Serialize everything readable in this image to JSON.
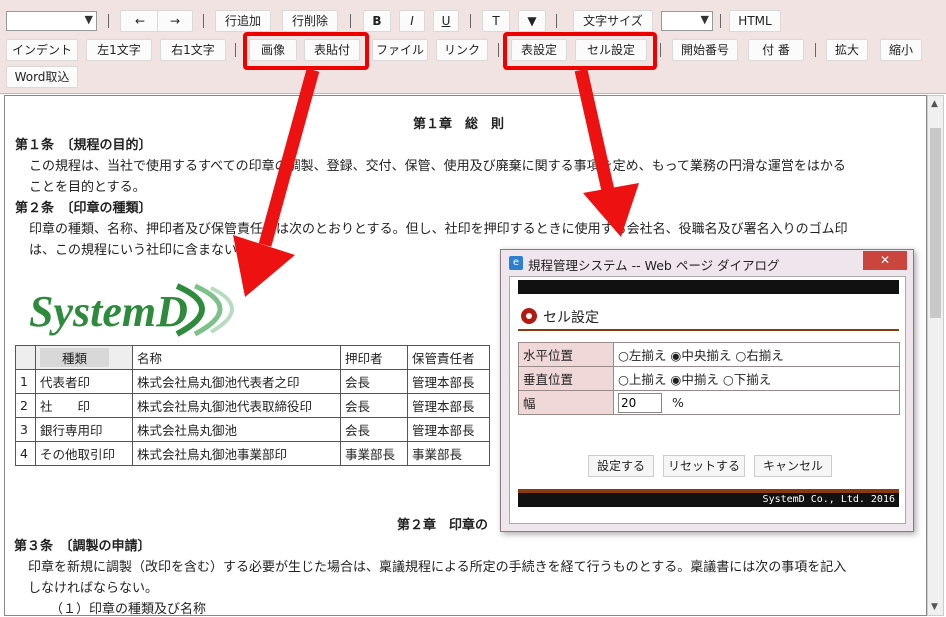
{
  "toolbar": {
    "row1": {
      "prev": "←",
      "next": "→",
      "add_row": "行追加",
      "del_row": "行削除",
      "bold": "B",
      "italic": "I",
      "underline": "U",
      "text": "T",
      "color_menu": "▼",
      "font_size": "文字サイズ",
      "html": "HTML"
    },
    "row2": {
      "indent": "インデント",
      "left_char": "左1文字",
      "right_char": "右1文字",
      "image": "画像",
      "paste_table": "表貼付",
      "file": "ファイル",
      "link": "リンク",
      "table_settings": "表設定",
      "cell_settings": "セル設定",
      "start_number": "開始番号",
      "numbering": "付 番",
      "zoom_in": "拡大",
      "zoom_out": "縮小"
    },
    "row3": {
      "word_import": "Word取込"
    }
  },
  "document": {
    "chapter1": "第１章　総　則",
    "art1_title": "第１条　〔規程の目的〕",
    "art1_line1": "この規程は、当社で使用するすべての印章の調製、登録、交付、保管、使用及び廃棄に関する事項を定め、もって業務の円滑な運営をはかる",
    "art1_line2": "ことを目的とする。",
    "art2_title": "第２条　〔印章の種類〕",
    "art2_line1": "印章の種類、名称、押印者及び保管責任者は次のとおりとする。但し、社印を押印するときに使用する会社名、役職名及び署名入りのゴム印",
    "art2_line2": "は、この規程にいう社印に含まない。",
    "logo_text": "SystemD",
    "table": {
      "headers": [
        "",
        "種類",
        "名称",
        "押印者",
        "保管責任者"
      ],
      "rows": [
        [
          "1",
          "代表者印",
          "株式会社鳥丸御池代表者之印",
          "会長",
          "管理本部長"
        ],
        [
          "2",
          "社　　印",
          "株式会社鳥丸御池代表取締役印",
          "会長",
          "管理本部長"
        ],
        [
          "3",
          "銀行専用印",
          "株式会社鳥丸御池",
          "会長",
          "管理本部長"
        ],
        [
          "4",
          "その他取引印",
          "株式会社鳥丸御池事業部印",
          "事業部長",
          "事業部長"
        ]
      ]
    },
    "chapter2": "第２章　印章の",
    "art3_title": "第３条　〔調製の申請〕",
    "art3_line1": "印章を新規に調製（改印を含む）する必要が生じた場合は、稟議規程による所定の手続きを経て行うものとする。稟議書には次の事項を記入",
    "art3_line2": "しなければならない。",
    "art3_item1": "（１）印章の種類及び名称"
  },
  "dialog": {
    "title": "規程管理システム -- Web ページ ダイアログ",
    "close": "✕",
    "heading": "セル設定",
    "h_label": "水平位置",
    "h_options": [
      "左揃え",
      "中央揃え",
      "右揃え"
    ],
    "h_selected": 1,
    "v_label": "垂直位置",
    "v_options": [
      "上揃え",
      "中揃え",
      "下揃え"
    ],
    "v_selected": 1,
    "width_label": "幅",
    "width_value": "20",
    "width_unit": "%",
    "btn_set": "設定する",
    "btn_reset": "リセットする",
    "btn_cancel": "キャンセル",
    "footer": "SystemD Co., Ltd. 2016"
  },
  "colors": {
    "toolbar_bg": "#f2e3e3",
    "highlight": "#ee0000",
    "accent_brown": "#8a3a10",
    "logo_green": "#2e8b3e"
  }
}
